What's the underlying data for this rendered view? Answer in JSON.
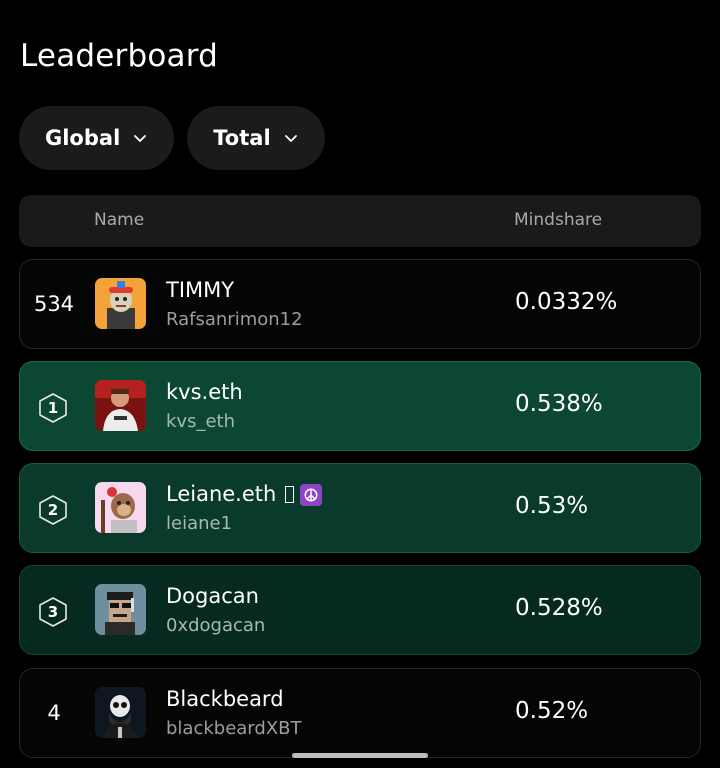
{
  "page_title": "Leaderboard",
  "filters": [
    {
      "label": "Global",
      "icon": "chevron-down-icon"
    },
    {
      "label": "Total",
      "icon": "chevron-down-icon"
    }
  ],
  "table_header": {
    "name": "Name",
    "mindshare": "Mindshare"
  },
  "current_user": {
    "rank": "534",
    "name": "TIMMY",
    "handle": "Rafsanrimon12",
    "mindshare": "0.0332%"
  },
  "rows": [
    {
      "rank": "1",
      "name": "kvs.eth",
      "handle": "kvs_eth",
      "mindshare": "0.538%"
    },
    {
      "rank": "2",
      "name": "Leiane.eth",
      "handle": "leiane1",
      "mindshare": "0.53%"
    },
    {
      "rank": "3",
      "name": "Dogacan",
      "handle": "0xdogacan",
      "mindshare": "0.528%"
    },
    {
      "rank": "4",
      "name": "Blackbeard",
      "handle": "blackbeardXBT",
      "mindshare": "0.52%"
    }
  ],
  "colors": {
    "background": "#000000",
    "rank1": "#0c4733",
    "rank2": "#093a2b",
    "rank3": "#072a20",
    "pill": "#1b1b1b"
  }
}
